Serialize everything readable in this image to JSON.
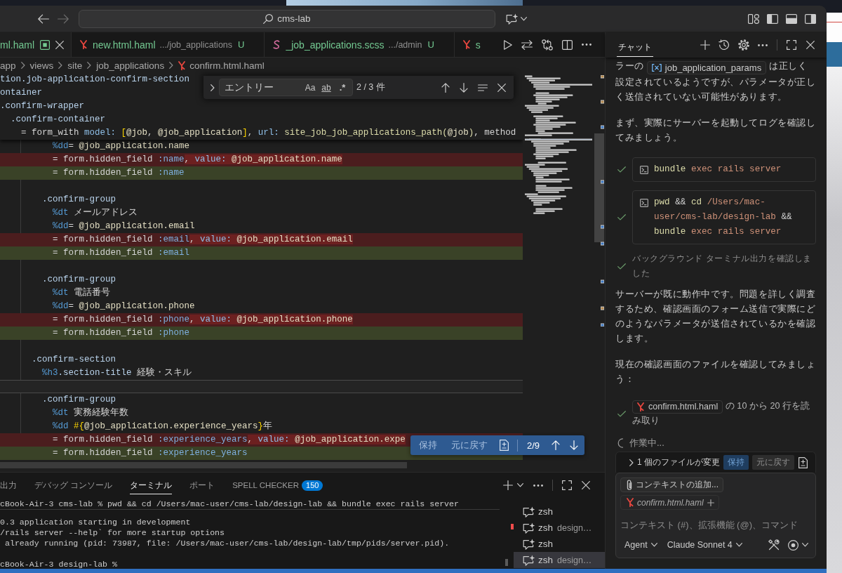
{
  "title_bar": {
    "navigation": [
      {
        "kind": "back",
        "disabled": false
      },
      {
        "kind": "forward",
        "disabled": true
      }
    ],
    "command_center": "cms-lab"
  },
  "editor": {
    "tabs": [
      {
        "label": "ml.haml",
        "selected": true,
        "indicator": true
      },
      {
        "label": "new.html.haml",
        "kind": "haml",
        "description": ".../job_applications",
        "git_status": "U",
        "selected": false,
        "indicator": false
      },
      {
        "label": "_job_applications.scss",
        "kind": "scss",
        "description": ".../admin",
        "git_status": "U",
        "selected": false,
        "indicator": false
      },
      {
        "label": "s",
        "kind": "haml",
        "selected": false,
        "indicator": false
      }
    ],
    "breadcrumbs": [
      {
        "label": "app"
      },
      {
        "label": "views"
      },
      {
        "label": "site"
      },
      {
        "label": "job_applications"
      },
      {
        "label": "confirm.html.haml",
        "kind": "haml"
      }
    ],
    "find_widget": {
      "query": "エントリー",
      "toggles": [
        {
          "kind": "case",
          "label": "Aa",
          "on": false
        },
        {
          "kind": "word",
          "label": "ab",
          "on": false
        },
        {
          "kind": "regex",
          "label": ".*",
          "on": false
        }
      ],
      "result": "2 / 3 件"
    },
    "sticky_lines": [
      "tion.job-application-confirm-section",
      "ontainer",
      ".confirm-wrapper",
      "  .confirm-container",
      "    = form_with model: [@job, @job_application], url: site_job_job_applications_path(@job), method"
    ],
    "lines": [
      {
        "kind": "code",
        "text": "          %dd= @job_application.name",
        "current": false
      },
      {
        "kind": "deleted",
        "text": "          = form.hidden_field :name",
        "removed": ", value: @job_application.name",
        "current": false
      },
      {
        "kind": "added",
        "text": "          = form.hidden_field :name",
        "current": false
      },
      {
        "kind": "blank",
        "current": false
      },
      {
        "kind": "code",
        "text": "        .confirm-group",
        "current": false
      },
      {
        "kind": "code",
        "text": "          %dt メールアドレス",
        "current": false
      },
      {
        "kind": "code",
        "text": "          %dd= @job_application.email",
        "current": false
      },
      {
        "kind": "deleted",
        "text": "          = form.hidden_field :email",
        "removed": ", value: @job_application.email",
        "current": false
      },
      {
        "kind": "added",
        "text": "          = form.hidden_field :email",
        "current": false
      },
      {
        "kind": "blank",
        "current": false
      },
      {
        "kind": "code",
        "text": "        .confirm-group",
        "current": false
      },
      {
        "kind": "code",
        "text": "          %dt 電話番号",
        "current": false
      },
      {
        "kind": "code",
        "text": "          %dd= @job_application.phone",
        "current": false
      },
      {
        "kind": "deleted",
        "text": "          = form.hidden_field :phone",
        "removed": ", value: @job_application.phone",
        "current": false
      },
      {
        "kind": "added",
        "text": "          = form.hidden_field :phone",
        "current": false
      },
      {
        "kind": "blank",
        "current": false
      },
      {
        "kind": "code",
        "text": "      .confirm-section",
        "current": false
      },
      {
        "kind": "code",
        "text": "        %h3.section-title 経験・スキル",
        "current": false
      },
      {
        "kind": "blank",
        "current": true
      },
      {
        "kind": "code",
        "text": "        .confirm-group",
        "current": false
      },
      {
        "kind": "code",
        "text": "          %dt 実務経験年数",
        "current": false
      },
      {
        "kind": "code",
        "text": "          %dd #{@job_application.experience_years}年",
        "current": false
      },
      {
        "kind": "deleted",
        "text": "          = form.hidden_field :experience_years",
        "removed": ", value: @job_application.expe",
        "current": false
      },
      {
        "kind": "added",
        "text": "          = form.hidden_field :experience_years",
        "current": false
      }
    ],
    "diff_widget": {
      "keep": "保持",
      "undo": "元に戻す",
      "position": "2/9"
    }
  },
  "panel": {
    "tabs": [
      {
        "label": "出力",
        "selected": false
      },
      {
        "label": "デバッグ コンソール",
        "selected": false
      },
      {
        "label": "ターミナル",
        "selected": true
      },
      {
        "label": "ポート",
        "selected": false
      },
      {
        "label": "SPELL CHECKER",
        "badge": "150",
        "selected": false
      }
    ],
    "terminal": {
      "sticky_line": "cBook-Air-3 cms-lab % pwd && cd /Users/mac-user/cms-lab/design-lab && bundle exec rails server",
      "lines": [
        {
          "kind": "output",
          "text": "0.3 application starting in development"
        },
        {
          "kind": "output",
          "text": "/rails server --help` for more startup options"
        },
        {
          "kind": "output",
          "text": " already running (pid: 73987, file: /Users/mac-user/cms-lab/design-lab/tmp/pids/server.pid)."
        },
        {
          "kind": "blank"
        },
        {
          "kind": "output",
          "text": "cBook-Air-3 design-lab %"
        }
      ],
      "instances": [
        {
          "label": "zsh",
          "selected": false
        },
        {
          "label": "zsh",
          "description": "design…",
          "selected": false
        },
        {
          "label": "zsh",
          "selected": false
        },
        {
          "label": "zsh",
          "description": "design…",
          "selected": true
        }
      ]
    }
  },
  "chat": {
    "tabs": [
      {
        "label": "チャット",
        "selected": true
      }
    ],
    "messages": [
      {
        "kind": "paragraph",
        "before": "ラーの",
        "code": "job_application_params",
        "after": "は正しく設定されているようですが、パラメータが正しく送信されていない可能性があります。"
      },
      {
        "kind": "paragraph",
        "text": "まず、実際にサーバーを起動してログを確認してみましょう。"
      },
      {
        "kind": "command",
        "done": true,
        "command": "bundle exec rails server"
      },
      {
        "kind": "command",
        "done": true,
        "command": "pwd && cd /Users/mac-user/cms-lab/design-lab && bundle exec rails server"
      },
      {
        "kind": "status",
        "done": true,
        "text": "バックグラウンド ターミナル出力を確認しました"
      },
      {
        "kind": "paragraph",
        "text": "サーバーが既に動作中です。問題を詳しく調査するため、確認画面のフォーム送信で実際にどのようなパラメータが送信されているかを確認します。"
      },
      {
        "kind": "paragraph",
        "text": "現在の確認画面のファイルを確認してみましょう："
      },
      {
        "kind": "file_read",
        "done": true,
        "file": {
          "label": "confirm.html.haml",
          "kind": "haml"
        },
        "text": "の 10 から 20 行を読み取り"
      },
      {
        "kind": "progress",
        "text": "作業中..."
      }
    ],
    "changes": {
      "expanded": false,
      "label": "1 個のファイルが変更",
      "keep": "保持",
      "undo": "元に戻す"
    },
    "input": {
      "attachments": [
        {
          "kind": "add",
          "label": "コンテキストの追加..."
        },
        {
          "kind": "suggested",
          "file": {
            "label": "confirm.html.haml",
            "kind": "haml"
          }
        }
      ],
      "placeholder": "コンテキスト (#)、拡張機能 (@)、コマンド",
      "mode": "Agent",
      "model": "Claude Sonnet 4"
    }
  }
}
